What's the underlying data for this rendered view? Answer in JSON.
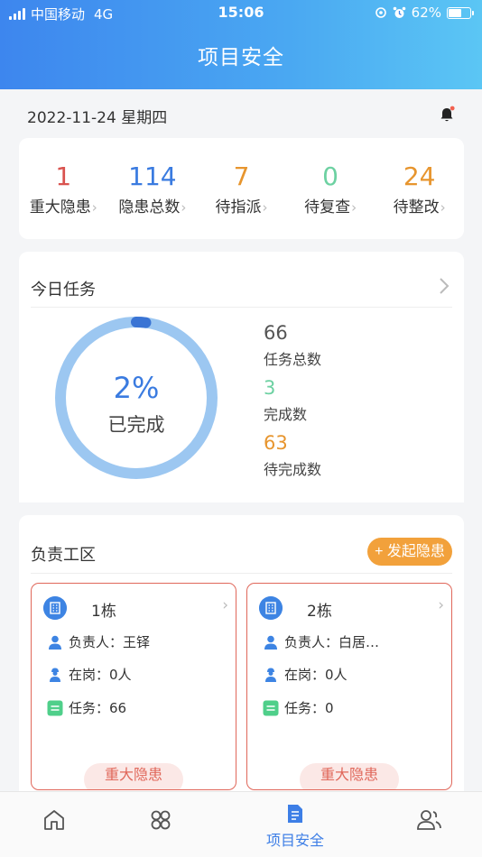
{
  "status_bar": {
    "carrier": "中国移动",
    "network": "4G",
    "time": "15:06",
    "battery": "62%",
    "battery_level": 0.62
  },
  "header": {
    "title": "项目安全"
  },
  "date_row": {
    "date": "2022-11-24 星期四",
    "notification_icon": "bell-icon",
    "badge_color": "#f2604f"
  },
  "stats": [
    {
      "value": "1",
      "label": "重大隐患",
      "color": "#d9534f"
    },
    {
      "value": "114",
      "label": "隐患总数",
      "color": "#3a7be0"
    },
    {
      "value": "7",
      "label": "待指派",
      "color": "#e7952e"
    },
    {
      "value": "0",
      "label": "待复查",
      "color": "#6dd1a2"
    },
    {
      "value": "24",
      "label": "待整改",
      "color": "#e7952e"
    }
  ],
  "today_tasks": {
    "title": "今日任务",
    "progress_percent": "2%",
    "progress_fraction": 0.02,
    "progress_label": "已完成",
    "total": {
      "value": "66",
      "label": "任务总数",
      "color": "#555555"
    },
    "done": {
      "value": "3",
      "label": "完成数",
      "color": "#6dd1a2"
    },
    "pending": {
      "value": "63",
      "label": "待完成数",
      "color": "#e7952e"
    }
  },
  "zones": {
    "title": "负责工区",
    "report_button": "+ 发起隐患",
    "items": [
      {
        "name": "1栋",
        "manager_label": "负责人：",
        "manager": "王铎",
        "onduty_label": "在岗：",
        "onduty": "0人",
        "task_label": "任务：",
        "tasks": "66",
        "tag": "重大隐患"
      },
      {
        "name": "2栋",
        "manager_label": "负责人：",
        "manager": "白居…",
        "onduty_label": "在岗：",
        "onduty": "0人",
        "task_label": "任务：",
        "tasks": "0",
        "tag": "重大隐患"
      }
    ]
  },
  "bottom_nav": {
    "items": [
      {
        "icon": "home-icon"
      },
      {
        "icon": "apps-icon"
      },
      {
        "icon": "document-icon",
        "label": "项目安全",
        "active": true
      },
      {
        "icon": "users-icon"
      }
    ],
    "active_color": "#3d7ee6"
  }
}
